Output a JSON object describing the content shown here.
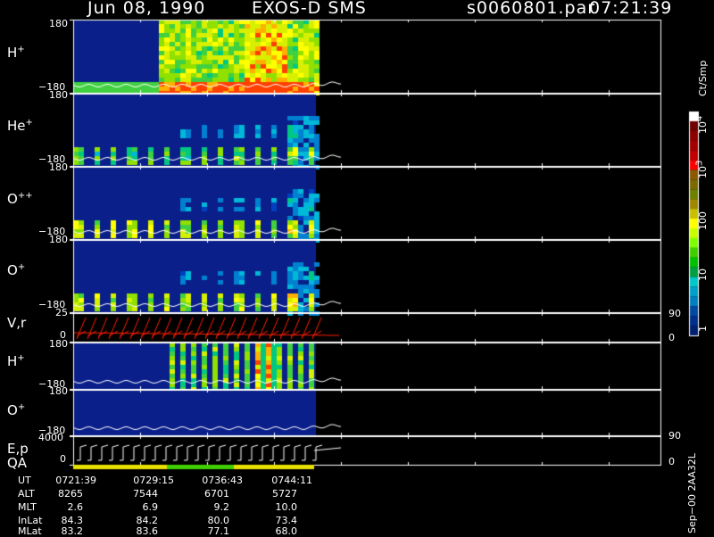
{
  "header": {
    "date": "Jun 08, 1990",
    "mission": "EXOS-D SMS",
    "file": "s0060801.par",
    "time": "07:21:39"
  },
  "panels": [
    {
      "id": "h_plus_1",
      "label_base": "H",
      "label_sup": "+",
      "ytop": "180",
      "ybot": "−180"
    },
    {
      "id": "he_plus",
      "label_base": "He",
      "label_sup": "+",
      "ytop": "180",
      "ybot": "−180"
    },
    {
      "id": "o_plusplus",
      "label_base": "O",
      "label_sup": "++",
      "ytop": "180",
      "ybot": "−180"
    },
    {
      "id": "o_plus_1",
      "label_base": "O",
      "label_sup": "+",
      "ytop": "180",
      "ybot": "−180"
    },
    {
      "id": "vr",
      "label_base": "V,r",
      "label_sup": "",
      "ytop": "25",
      "ybot": "0",
      "rtop": "90",
      "rbot": "0"
    },
    {
      "id": "h_plus_2",
      "label_base": "H",
      "label_sup": "+",
      "ytop": "180",
      "ybot": "−180"
    },
    {
      "id": "o_plus_2",
      "label_base": "O",
      "label_sup": "+",
      "ytop": "180",
      "ybot": "−180"
    },
    {
      "id": "ep",
      "label_base": "E,p",
      "label_sup": "",
      "ytop": "4000",
      "ybot": "0",
      "rtop": "90",
      "rbot": "0"
    }
  ],
  "qa_label": "QA",
  "colorbar": {
    "unit": "Ct/Smp",
    "tick_10_4": "10",
    "tick_10_4_exp": "4",
    "tick_10_3": "10",
    "tick_10_3_exp": "3",
    "tick_100": "100",
    "tick_10": "10",
    "tick_1": "1",
    "colors": [
      "#ffffff",
      "#6e0000",
      "#8c0000",
      "#a30000",
      "#c00000",
      "#ff0000",
      "#8b5a00",
      "#7a6a00",
      "#6e8000",
      "#a08800",
      "#c8c000",
      "#ffff00",
      "#c8ff00",
      "#80ff00",
      "#40d000",
      "#00c000",
      "#00a040",
      "#00c8c8",
      "#00a0c8",
      "#0080c0",
      "#004aa0",
      "#00308a",
      "#002070"
    ]
  },
  "chart_data": {
    "type": "heatmap",
    "title": "Jun 08, 1990   EXOS-D SMS",
    "time_axis": [
      "0721:39",
      "0729:15",
      "0736:43",
      "0744:11"
    ],
    "data_coverage_end": "0744:11",
    "ylim_pitch": [
      -180,
      180
    ],
    "ylim_velocity": [
      0,
      25
    ],
    "ylim_energy": [
      0,
      4000
    ],
    "ylim_right_angle": [
      0,
      90
    ],
    "colorbar_range": [
      1,
      10000
    ],
    "colorbar_scale": "log",
    "colorbar_unit": "Ct/Smp"
  },
  "orbit_table": {
    "rows": [
      {
        "label": "UT",
        "values": [
          "0721:39",
          "0729:15",
          "0736:43",
          "0744:11"
        ]
      },
      {
        "label": "ALT",
        "values": [
          "8265",
          "7544",
          "6701",
          "5727"
        ]
      },
      {
        "label": "MLT",
        "values": [
          "2.6",
          "6.9",
          "9.2",
          "10.0"
        ]
      },
      {
        "label": "InLat",
        "values": [
          "84.3",
          "84.2",
          "80.0",
          "73.4"
        ]
      },
      {
        "label": "MLat",
        "values": [
          "83.2",
          "83.6",
          "77.1",
          "68.0"
        ]
      }
    ]
  },
  "footer_vertical": "Sep−00  2AA32L"
}
